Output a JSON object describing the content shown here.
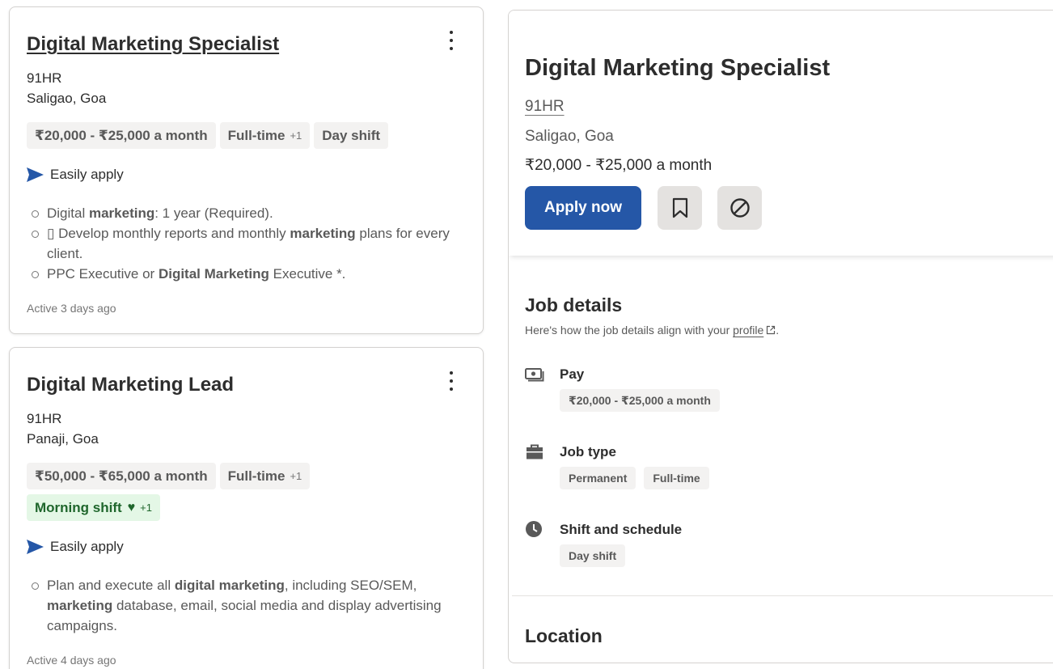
{
  "colors": {
    "primary": "#2557a7",
    "text": "#2d2d2d",
    "muted": "#595959",
    "chip_bg": "#f3f2f1",
    "green_bg": "#e4f7e6",
    "green_text": "#1f662c"
  },
  "cards": [
    {
      "title": "Digital Marketing Specialist",
      "company": "91HR",
      "location": "Saligao, Goa",
      "chips": {
        "salary": "₹20,000 - ₹25,000 a month",
        "type": "Full-time",
        "type_more": "+1",
        "shift": "Day shift"
      },
      "easy_apply": "Easily apply",
      "snippet": [
        {
          "pre": "Digital ",
          "bold": "marketing",
          "post": ": 1 year (Required)."
        },
        {
          "pre": "▯ Develop monthly reports and monthly ",
          "bold": "marketing",
          "post": " plans for every client."
        },
        {
          "pre": "PPC Executive or ",
          "bold": "Digital Marketing",
          "post": " Executive *."
        }
      ],
      "active": "Active 3 days ago"
    },
    {
      "title": "Digital Marketing Lead",
      "company": "91HR",
      "location": "Panaji, Goa",
      "chips": {
        "salary": "₹50,000 - ₹65,000 a month",
        "type": "Full-time",
        "type_more": "+1",
        "shift": "Morning shift",
        "shift_more": "+1"
      },
      "easy_apply": "Easily apply",
      "snippet": [
        {
          "pre": "Plan and execute all ",
          "bold": "digital marketing",
          "post": ", including SEO/SEM, ",
          "bold2": "marketing",
          "post2": " database, email, social media and display advertising campaigns."
        }
      ],
      "active": "Active 4 days ago"
    }
  ],
  "detail": {
    "title": "Digital Marketing Specialist",
    "company": "91HR",
    "location": "Saligao, Goa",
    "pay": "₹20,000 - ₹25,000 a month",
    "apply_label": "Apply now",
    "job_details": {
      "title": "Job details",
      "subtitle_pre": "Here's how the job details align with your ",
      "subtitle_link": "profile",
      "subtitle_post": ".",
      "pay_label": "Pay",
      "pay_value": "₹20,000 - ₹25,000 a month",
      "type_label": "Job type",
      "type_values": [
        "Permanent",
        "Full-time"
      ],
      "shift_label": "Shift and schedule",
      "shift_value": "Day shift"
    },
    "location_title": "Location"
  }
}
